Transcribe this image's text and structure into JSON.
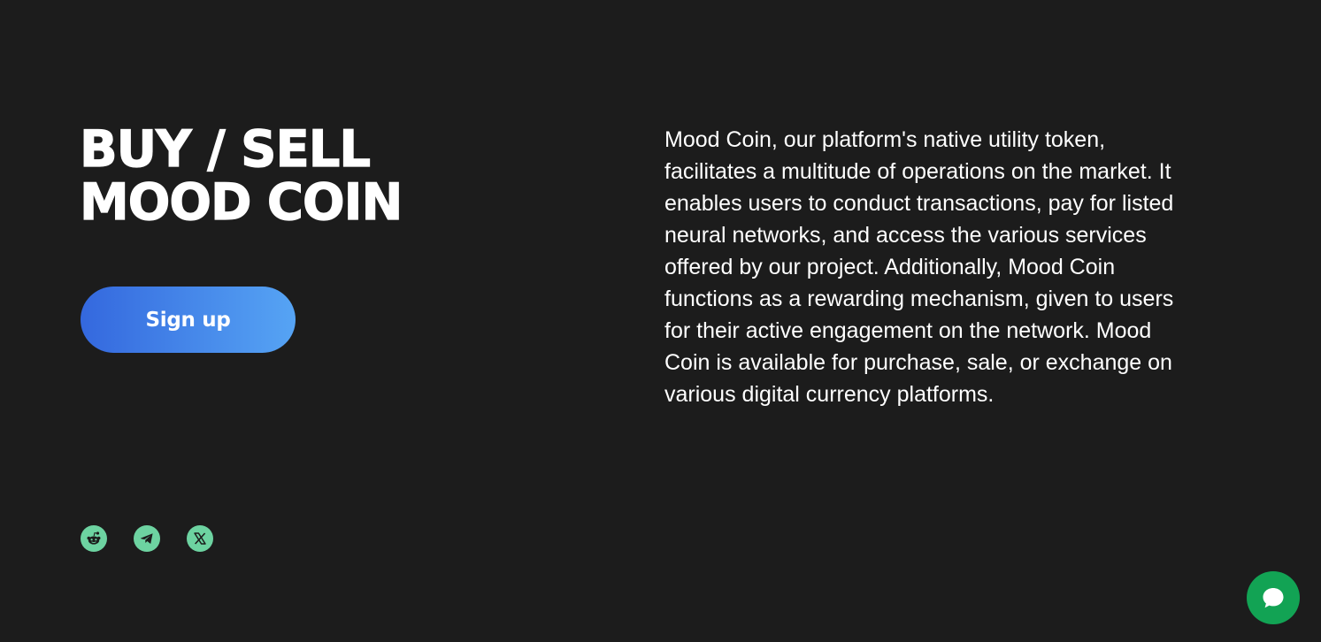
{
  "hero": {
    "headline_lines": [
      "BUY / SELL",
      "MOOD COIN"
    ],
    "signup_label": "Sign up",
    "description_lines": [
      "Mood Coin, our platform's native utility token,",
      "facilitates a multitude of operations on the market. It",
      "enables users to conduct transactions, pay for listed",
      "neural networks, and access the various services",
      "offered by our project. Additionally, Mood Coin",
      "functions as a rewarding mechanism, given to users",
      "for their active engagement on the network. Mood",
      "Coin is available for purchase, sale, or exchange on",
      "various digital currency platforms."
    ]
  },
  "socials": [
    {
      "icon": "reddit-icon"
    },
    {
      "icon": "telegram-icon"
    },
    {
      "icon": "x-icon"
    }
  ],
  "chat": {
    "icon": "chat-bubble-icon"
  },
  "colors": {
    "background": "#1c1c1c",
    "button_gradient_start": "#3468de",
    "button_gradient_end": "#56a4f4",
    "social_icon_bg": "#6dd3a1",
    "chat_bg": "#12a354",
    "text": "#ffffff"
  }
}
